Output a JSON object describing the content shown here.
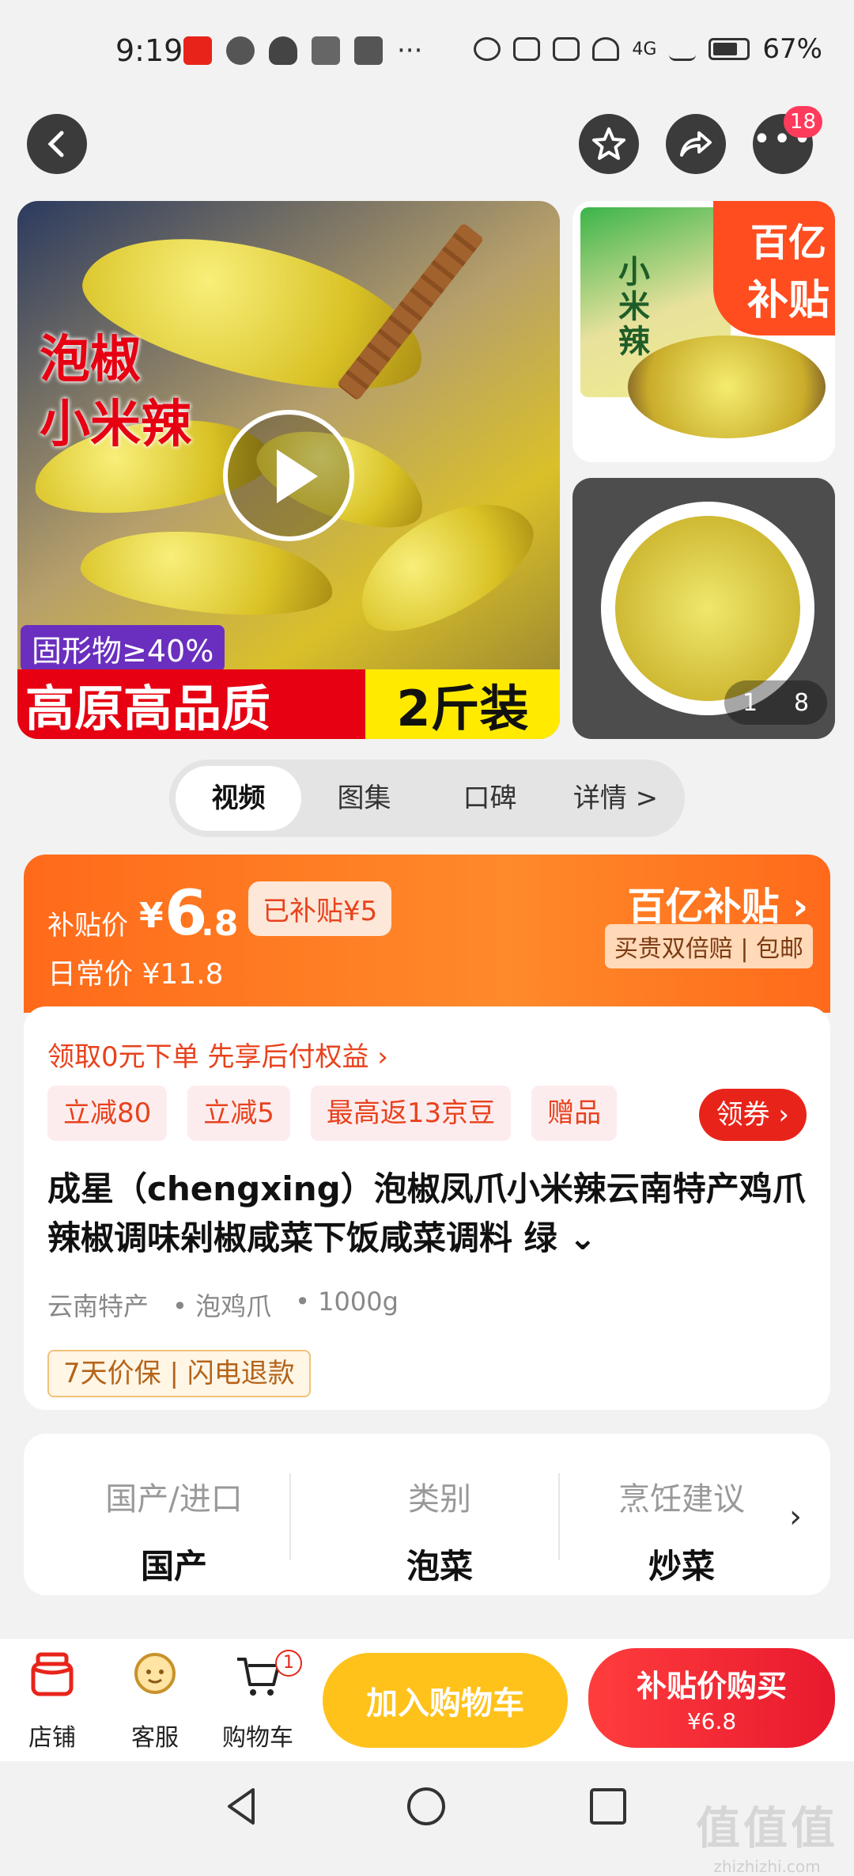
{
  "status_bar": {
    "time": "9:19",
    "apps_more": "···",
    "network": "4G",
    "battery_pct": "67%"
  },
  "top_actions": {
    "badge_count": "18"
  },
  "gallery": {
    "main_text_line1": "泡椒",
    "main_text_line2": "小米辣",
    "solids_label": "固形物≥40%",
    "banner_left": "高原高品质",
    "banner_right": "2斤装",
    "thumb1_bag_text": "小米辣",
    "corner_line1": "百亿",
    "corner_line2": "补贴",
    "pager_current": "1",
    "pager_total": "8"
  },
  "tabs": [
    {
      "label": "视频"
    },
    {
      "label": "图集"
    },
    {
      "label": "口碑"
    },
    {
      "label": "详情 >"
    }
  ],
  "price": {
    "label": "补贴价",
    "yen": "¥",
    "integer": "6",
    "decimal": ".8",
    "subsidized": "已补贴¥5",
    "daily": "日常价 ¥11.8",
    "brand": "百亿补贴 ›",
    "brand_sub": "买贵双倍赔 | 包邮"
  },
  "info": {
    "promo": "领取0元下单 先享后付权益 ›",
    "chips": [
      "立减80",
      "立减5",
      "最高返13京豆",
      "赠品"
    ],
    "coupon": "领券 ›",
    "title": "成星（chengxing）泡椒凤爪小米辣云南特产鸡爪辣椒调味剁椒咸菜下饭咸菜调料 绿 ⌄",
    "attrs": [
      "云南特产",
      "• 泡鸡爪",
      "• 1000g"
    ],
    "guarantee": "7天价保 | 闪电退款"
  },
  "specs": {
    "items": [
      {
        "key": "国产/进口",
        "value": "国产"
      },
      {
        "key": "类别",
        "value": "泡菜"
      },
      {
        "key": "烹饪建议",
        "value": "炒菜"
      }
    ],
    "more": "›"
  },
  "bottom_bar": {
    "store": "店铺",
    "service": "客服",
    "cart": "购物车",
    "cart_badge": "1",
    "add_to_cart": "加入购物车",
    "buy_now": "补贴价购买",
    "buy_now_price": "¥6.8"
  },
  "watermark": {
    "logo": "值值值",
    "site": "zhizhizhi.com"
  },
  "colors": {
    "accent_orange": "#ff6a1a",
    "accent_red": "#e8241a",
    "cart_yellow": "#ffc21a"
  }
}
